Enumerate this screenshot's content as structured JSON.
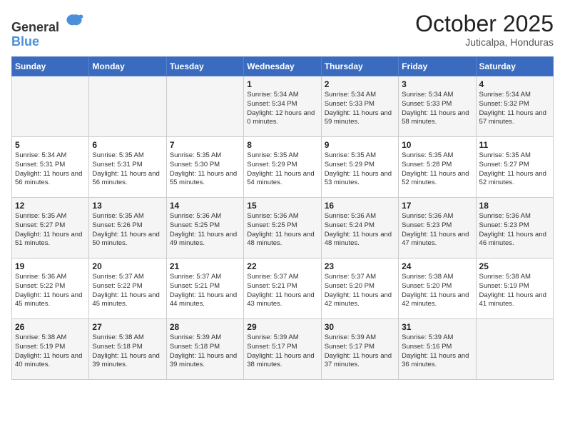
{
  "header": {
    "logo_general": "General",
    "logo_blue": "Blue",
    "month": "October 2025",
    "location": "Juticalpa, Honduras"
  },
  "days_of_week": [
    "Sunday",
    "Monday",
    "Tuesday",
    "Wednesday",
    "Thursday",
    "Friday",
    "Saturday"
  ],
  "weeks": [
    [
      {
        "day": "",
        "sunrise": "",
        "sunset": "",
        "daylight": ""
      },
      {
        "day": "",
        "sunrise": "",
        "sunset": "",
        "daylight": ""
      },
      {
        "day": "",
        "sunrise": "",
        "sunset": "",
        "daylight": ""
      },
      {
        "day": "1",
        "sunrise": "Sunrise: 5:34 AM",
        "sunset": "Sunset: 5:34 PM",
        "daylight": "Daylight: 12 hours and 0 minutes."
      },
      {
        "day": "2",
        "sunrise": "Sunrise: 5:34 AM",
        "sunset": "Sunset: 5:33 PM",
        "daylight": "Daylight: 11 hours and 59 minutes."
      },
      {
        "day": "3",
        "sunrise": "Sunrise: 5:34 AM",
        "sunset": "Sunset: 5:33 PM",
        "daylight": "Daylight: 11 hours and 58 minutes."
      },
      {
        "day": "4",
        "sunrise": "Sunrise: 5:34 AM",
        "sunset": "Sunset: 5:32 PM",
        "daylight": "Daylight: 11 hours and 57 minutes."
      }
    ],
    [
      {
        "day": "5",
        "sunrise": "Sunrise: 5:34 AM",
        "sunset": "Sunset: 5:31 PM",
        "daylight": "Daylight: 11 hours and 56 minutes."
      },
      {
        "day": "6",
        "sunrise": "Sunrise: 5:35 AM",
        "sunset": "Sunset: 5:31 PM",
        "daylight": "Daylight: 11 hours and 56 minutes."
      },
      {
        "day": "7",
        "sunrise": "Sunrise: 5:35 AM",
        "sunset": "Sunset: 5:30 PM",
        "daylight": "Daylight: 11 hours and 55 minutes."
      },
      {
        "day": "8",
        "sunrise": "Sunrise: 5:35 AM",
        "sunset": "Sunset: 5:29 PM",
        "daylight": "Daylight: 11 hours and 54 minutes."
      },
      {
        "day": "9",
        "sunrise": "Sunrise: 5:35 AM",
        "sunset": "Sunset: 5:29 PM",
        "daylight": "Daylight: 11 hours and 53 minutes."
      },
      {
        "day": "10",
        "sunrise": "Sunrise: 5:35 AM",
        "sunset": "Sunset: 5:28 PM",
        "daylight": "Daylight: 11 hours and 52 minutes."
      },
      {
        "day": "11",
        "sunrise": "Sunrise: 5:35 AM",
        "sunset": "Sunset: 5:27 PM",
        "daylight": "Daylight: 11 hours and 52 minutes."
      }
    ],
    [
      {
        "day": "12",
        "sunrise": "Sunrise: 5:35 AM",
        "sunset": "Sunset: 5:27 PM",
        "daylight": "Daylight: 11 hours and 51 minutes."
      },
      {
        "day": "13",
        "sunrise": "Sunrise: 5:35 AM",
        "sunset": "Sunset: 5:26 PM",
        "daylight": "Daylight: 11 hours and 50 minutes."
      },
      {
        "day": "14",
        "sunrise": "Sunrise: 5:36 AM",
        "sunset": "Sunset: 5:25 PM",
        "daylight": "Daylight: 11 hours and 49 minutes."
      },
      {
        "day": "15",
        "sunrise": "Sunrise: 5:36 AM",
        "sunset": "Sunset: 5:25 PM",
        "daylight": "Daylight: 11 hours and 48 minutes."
      },
      {
        "day": "16",
        "sunrise": "Sunrise: 5:36 AM",
        "sunset": "Sunset: 5:24 PM",
        "daylight": "Daylight: 11 hours and 48 minutes."
      },
      {
        "day": "17",
        "sunrise": "Sunrise: 5:36 AM",
        "sunset": "Sunset: 5:23 PM",
        "daylight": "Daylight: 11 hours and 47 minutes."
      },
      {
        "day": "18",
        "sunrise": "Sunrise: 5:36 AM",
        "sunset": "Sunset: 5:23 PM",
        "daylight": "Daylight: 11 hours and 46 minutes."
      }
    ],
    [
      {
        "day": "19",
        "sunrise": "Sunrise: 5:36 AM",
        "sunset": "Sunset: 5:22 PM",
        "daylight": "Daylight: 11 hours and 45 minutes."
      },
      {
        "day": "20",
        "sunrise": "Sunrise: 5:37 AM",
        "sunset": "Sunset: 5:22 PM",
        "daylight": "Daylight: 11 hours and 45 minutes."
      },
      {
        "day": "21",
        "sunrise": "Sunrise: 5:37 AM",
        "sunset": "Sunset: 5:21 PM",
        "daylight": "Daylight: 11 hours and 44 minutes."
      },
      {
        "day": "22",
        "sunrise": "Sunrise: 5:37 AM",
        "sunset": "Sunset: 5:21 PM",
        "daylight": "Daylight: 11 hours and 43 minutes."
      },
      {
        "day": "23",
        "sunrise": "Sunrise: 5:37 AM",
        "sunset": "Sunset: 5:20 PM",
        "daylight": "Daylight: 11 hours and 42 minutes."
      },
      {
        "day": "24",
        "sunrise": "Sunrise: 5:38 AM",
        "sunset": "Sunset: 5:20 PM",
        "daylight": "Daylight: 11 hours and 42 minutes."
      },
      {
        "day": "25",
        "sunrise": "Sunrise: 5:38 AM",
        "sunset": "Sunset: 5:19 PM",
        "daylight": "Daylight: 11 hours and 41 minutes."
      }
    ],
    [
      {
        "day": "26",
        "sunrise": "Sunrise: 5:38 AM",
        "sunset": "Sunset: 5:19 PM",
        "daylight": "Daylight: 11 hours and 40 minutes."
      },
      {
        "day": "27",
        "sunrise": "Sunrise: 5:38 AM",
        "sunset": "Sunset: 5:18 PM",
        "daylight": "Daylight: 11 hours and 39 minutes."
      },
      {
        "day": "28",
        "sunrise": "Sunrise: 5:39 AM",
        "sunset": "Sunset: 5:18 PM",
        "daylight": "Daylight: 11 hours and 39 minutes."
      },
      {
        "day": "29",
        "sunrise": "Sunrise: 5:39 AM",
        "sunset": "Sunset: 5:17 PM",
        "daylight": "Daylight: 11 hours and 38 minutes."
      },
      {
        "day": "30",
        "sunrise": "Sunrise: 5:39 AM",
        "sunset": "Sunset: 5:17 PM",
        "daylight": "Daylight: 11 hours and 37 minutes."
      },
      {
        "day": "31",
        "sunrise": "Sunrise: 5:39 AM",
        "sunset": "Sunset: 5:16 PM",
        "daylight": "Daylight: 11 hours and 36 minutes."
      },
      {
        "day": "",
        "sunrise": "",
        "sunset": "",
        "daylight": ""
      }
    ]
  ]
}
